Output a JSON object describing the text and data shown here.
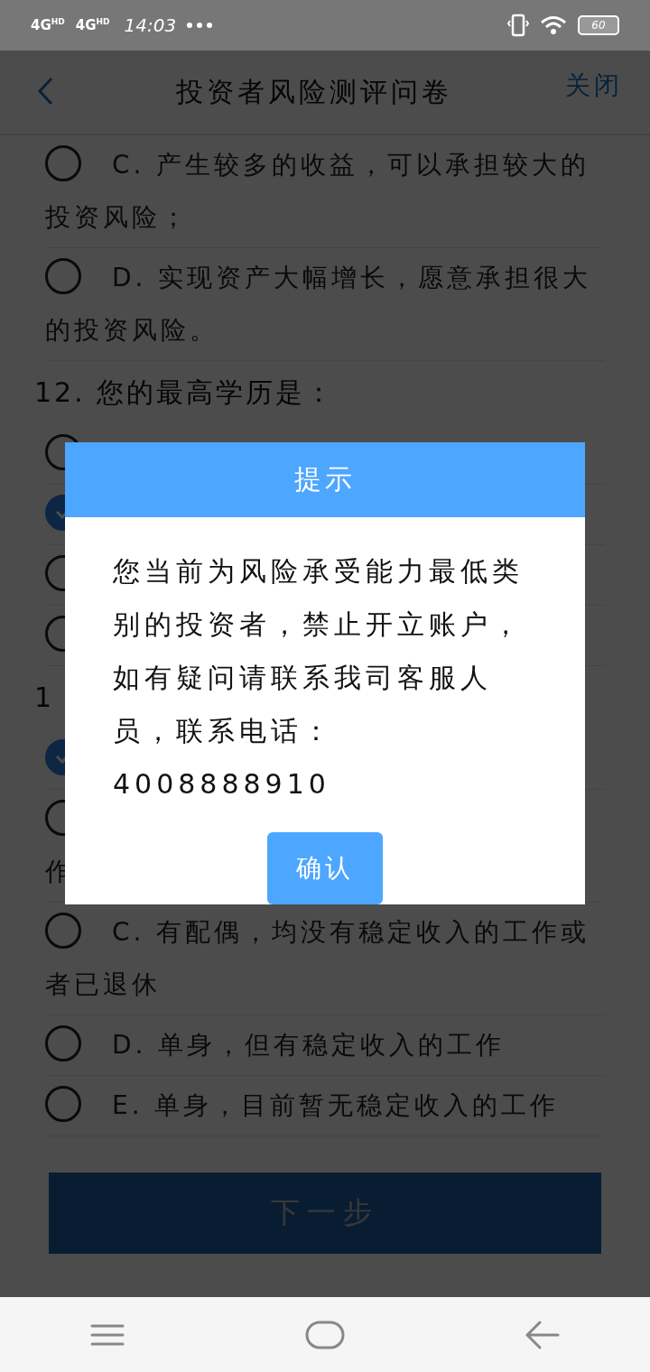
{
  "status_bar": {
    "networks": [
      "4G$^{HD}$",
      "4G$^{HD}$"
    ],
    "time": "14:03",
    "battery": "60"
  },
  "header": {
    "title": "投资者风险测评问卷",
    "close": "关闭"
  },
  "sections": [
    {
      "options": [
        {
          "text": "C. 产生较多的收益，可以承担较大的投资风险；",
          "selected": false
        },
        {
          "text": "D. 实现资产大幅增长，愿意承担很大的投资风险。",
          "selected": false
        }
      ]
    },
    {
      "title": "12. 您的最高学历是：",
      "options": [
        {
          "selected": false
        },
        {
          "selected": true
        },
        {
          "selected": false
        },
        {
          "selected": false
        }
      ]
    },
    {
      "title": "1",
      "options": [
        {
          "selected": true
        },
        {
          "text_tail": "作",
          "selected": false
        },
        {
          "text": "C. 有配偶，均没有稳定收入的工作或者已退休",
          "selected": false
        },
        {
          "text": "D. 单身，但有稳定收入的工作",
          "selected": false
        },
        {
          "text": "E. 单身，目前暂无稳定收入的工作",
          "selected": false
        }
      ]
    }
  ],
  "next_button": "下一步",
  "dialog": {
    "title": "提示",
    "message": "您当前为风险承受能力最低类别的投资者，禁止开立账户，如有疑问请联系我司客服人员，联系电话：4008888910",
    "confirm": "确认"
  }
}
